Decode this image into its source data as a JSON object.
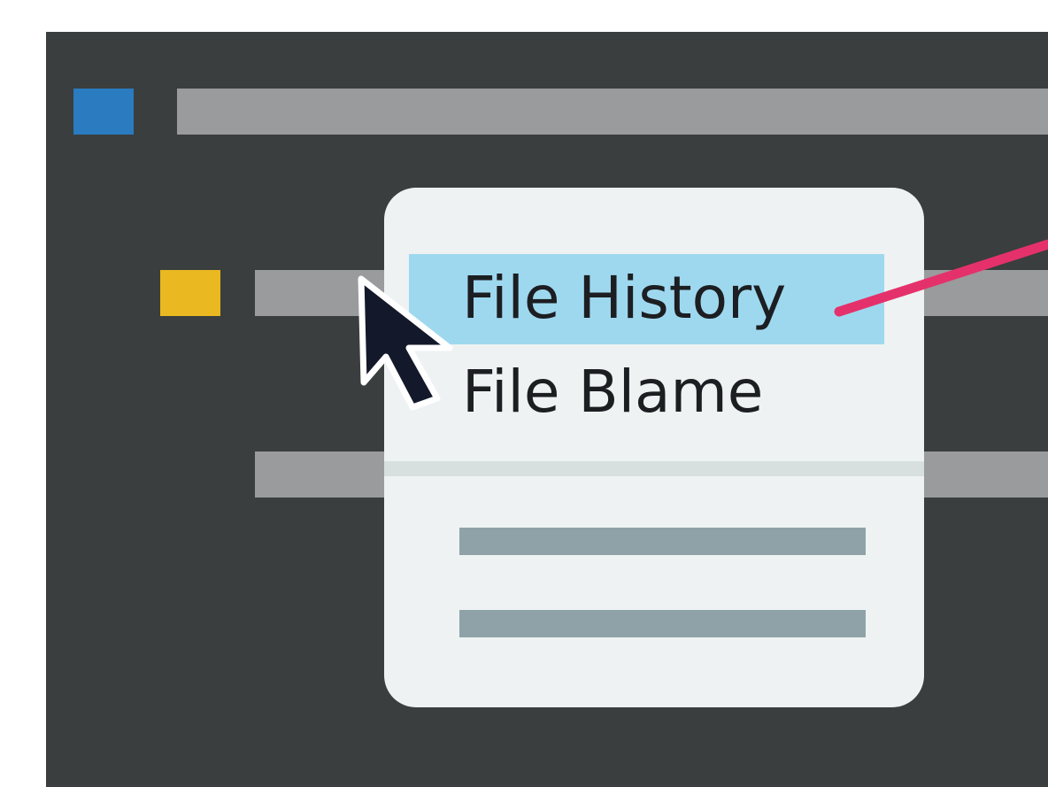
{
  "colors": {
    "window_background": "#3a3e3e",
    "placeholder_bar": "#9a9b9c",
    "file_icon_blue": "#2a7bc0",
    "file_icon_yellow": "#eab821",
    "menu_background": "#eef2f3",
    "menu_highlight": "#9ed8ef",
    "menu_divider": "#d7e0df",
    "menu_placeholder": "#8fa2a8",
    "callout_line": "#e5316b",
    "cursor": "#13192a"
  },
  "context_menu": {
    "items": [
      {
        "label": "File History",
        "highlighted": true
      },
      {
        "label": "File Blame",
        "highlighted": false
      }
    ]
  },
  "icons": {
    "cursor": "arrow-pointer-icon",
    "file_blue": "file-square-icon",
    "file_yellow": "file-square-icon"
  }
}
